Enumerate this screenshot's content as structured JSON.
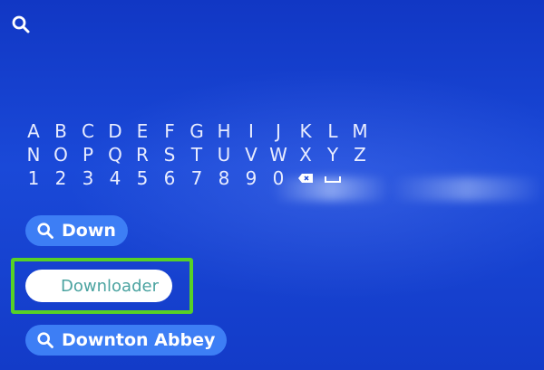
{
  "search": {
    "icon": "search-icon"
  },
  "keyboard": {
    "rows": [
      [
        "A",
        "B",
        "C",
        "D",
        "E",
        "F",
        "G",
        "H",
        "I",
        "J",
        "K",
        "L",
        "M"
      ],
      [
        "N",
        "O",
        "P",
        "Q",
        "R",
        "S",
        "T",
        "U",
        "V",
        "W",
        "X",
        "Y",
        "Z"
      ],
      [
        "1",
        "2",
        "3",
        "4",
        "5",
        "6",
        "7",
        "8",
        "9",
        "0"
      ]
    ],
    "special_keys": [
      "backspace-icon",
      "space-icon"
    ]
  },
  "suggestions": [
    {
      "label": "Down",
      "icon": "search-icon"
    },
    {
      "label": "Downloader",
      "focused": true
    },
    {
      "label": "Downton Abbey",
      "icon": "search-icon"
    }
  ],
  "colors": {
    "background": "#1a49d8",
    "pill": "#3d7ef5",
    "focus_border": "#57d126",
    "focused_text": "#4aa3a0"
  }
}
